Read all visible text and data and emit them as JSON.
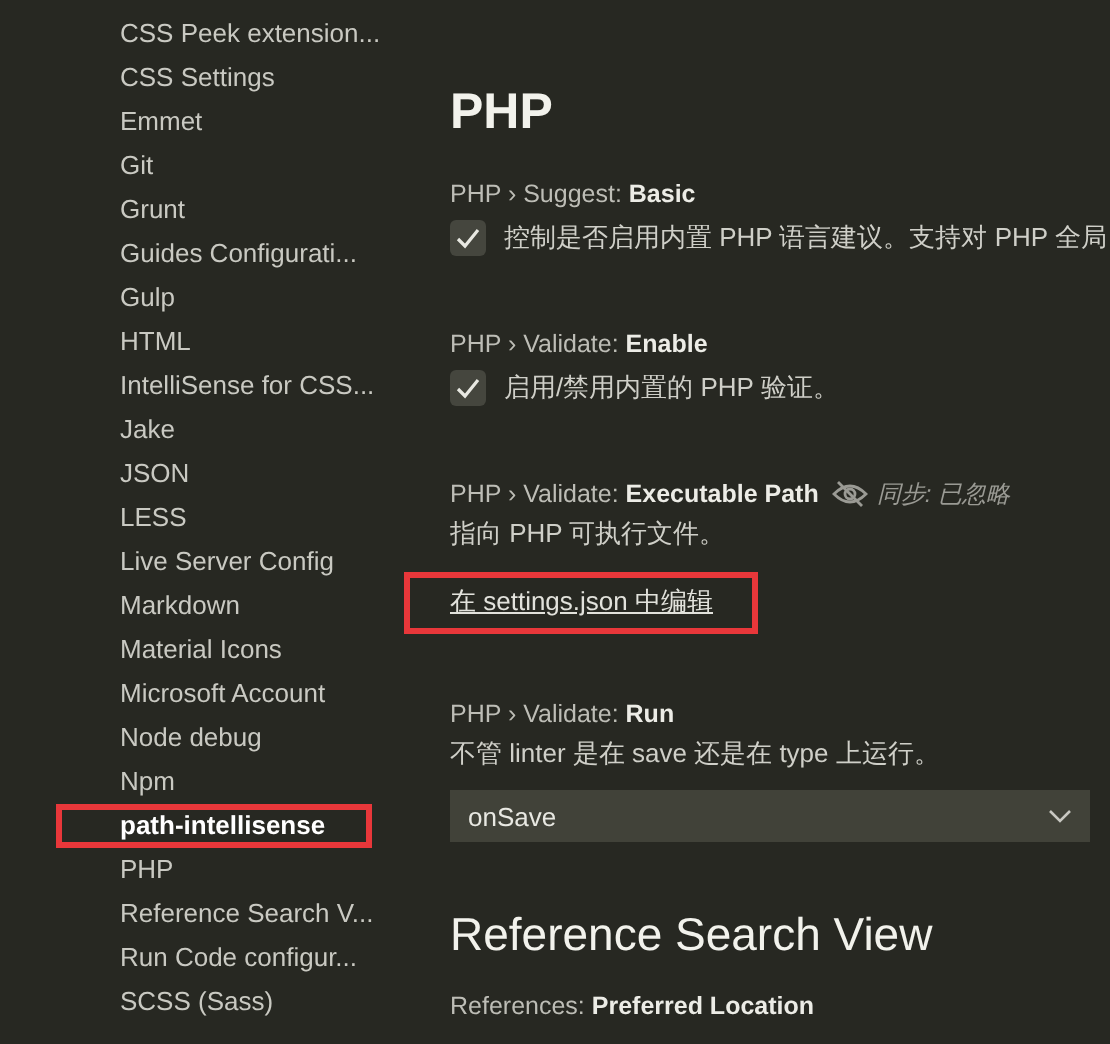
{
  "sidebar": {
    "items": [
      {
        "label": "CSS Peek extension...",
        "selected": false,
        "highlighted": false
      },
      {
        "label": "CSS Settings",
        "selected": false,
        "highlighted": false
      },
      {
        "label": "Emmet",
        "selected": false,
        "highlighted": false
      },
      {
        "label": "Git",
        "selected": false,
        "highlighted": false
      },
      {
        "label": "Grunt",
        "selected": false,
        "highlighted": false
      },
      {
        "label": "Guides Configurati...",
        "selected": false,
        "highlighted": false
      },
      {
        "label": "Gulp",
        "selected": false,
        "highlighted": false
      },
      {
        "label": "HTML",
        "selected": false,
        "highlighted": false
      },
      {
        "label": "IntelliSense for CSS...",
        "selected": false,
        "highlighted": false
      },
      {
        "label": "Jake",
        "selected": false,
        "highlighted": false
      },
      {
        "label": "JSON",
        "selected": false,
        "highlighted": false
      },
      {
        "label": "LESS",
        "selected": false,
        "highlighted": false
      },
      {
        "label": "Live Server Config",
        "selected": false,
        "highlighted": false
      },
      {
        "label": "Markdown",
        "selected": false,
        "highlighted": false
      },
      {
        "label": "Material Icons",
        "selected": false,
        "highlighted": false
      },
      {
        "label": "Microsoft Account",
        "selected": false,
        "highlighted": false
      },
      {
        "label": "Node debug",
        "selected": false,
        "highlighted": false
      },
      {
        "label": "Npm",
        "selected": false,
        "highlighted": false
      },
      {
        "label": "path-intellisense",
        "selected": true,
        "highlighted": true
      },
      {
        "label": "PHP",
        "selected": false,
        "highlighted": false
      },
      {
        "label": "Reference Search V...",
        "selected": false,
        "highlighted": false
      },
      {
        "label": "Run Code configur...",
        "selected": false,
        "highlighted": false
      },
      {
        "label": "SCSS (Sass)",
        "selected": false,
        "highlighted": false
      }
    ]
  },
  "sections": [
    {
      "title": "PHP",
      "settings": [
        {
          "kind": "checkbox",
          "category": "PHP › Suggest: ",
          "name": "Basic",
          "description": "控制是否启用内置 PHP 语言建议。支持对 PHP 全局",
          "checked": true
        },
        {
          "kind": "checkbox",
          "category": "PHP › Validate: ",
          "name": "Enable",
          "description": "启用/禁用内置的 PHP 验证。",
          "checked": true
        },
        {
          "kind": "link",
          "category": "PHP › Validate: ",
          "name": "Executable Path",
          "sync_note": "同步: 已忽略",
          "description": "指向 PHP 可执行文件。",
          "link": "在 settings.json 中编辑",
          "highlighted": true
        },
        {
          "kind": "dropdown",
          "category": "PHP › Validate: ",
          "name": "Run",
          "description": "不管 linter 是在 save 还是在 type 上运行。",
          "value": "onSave"
        }
      ]
    },
    {
      "title": "Reference Search View",
      "settings": [
        {
          "kind": "header",
          "category": "References: ",
          "name": "Preferred Location"
        }
      ]
    }
  ]
}
